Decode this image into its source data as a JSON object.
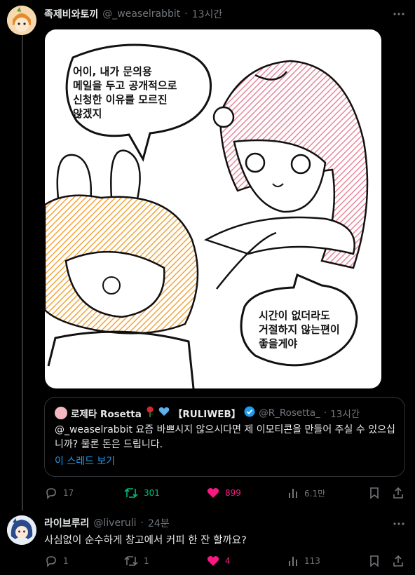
{
  "post": {
    "display_name": "족제비와토끼",
    "handle": "@_weaselrabbit",
    "separator": "·",
    "time": "13시간",
    "bubble1": "어이, 내가 문의용\n메일을 두고 공개적으로\n신청한 이유를 모르진\n않겠지",
    "bubble2": "시간이 없더라도\n거절하지 않는편이\n좋을게야",
    "quote": {
      "display_name": "로제타 Rosetta",
      "badge_text": "【RULIWEB】",
      "handle": "@R_Rosetta_",
      "separator": "·",
      "time": "13시간",
      "text": "@_weaselrabbit 요즘 바쁘시지 않으시다면 제 이모티콘을 만들어 주실 수 있으십니까? 물론 돈은 드립니다.",
      "show_thread": "이 스레드 보기"
    },
    "stats": {
      "replies": "17",
      "reposts": "301",
      "likes": "899",
      "views": "6.1만"
    }
  },
  "reply": {
    "display_name": "라이브루리",
    "handle": "@liveruli",
    "separator": "·",
    "time": "24분",
    "text": "사심없이 순수하게 창고에서 커피 한 잔 할까요?",
    "stats": {
      "replies": "1",
      "reposts": "1",
      "likes": "4",
      "views": "113"
    }
  },
  "colors": {
    "background": "#000000",
    "text": "#e7e9ea",
    "muted": "#71767b",
    "repost_active": "#00ba7c",
    "like_active": "#f91880",
    "link": "#1d9bf0",
    "verified": "#1d9bf0"
  },
  "icons": [
    "more-icon",
    "reply-icon",
    "repost-icon",
    "like-icon",
    "views-icon",
    "bookmark-icon",
    "share-icon",
    "verified-icon",
    "rose-icon",
    "blue-heart-icon"
  ]
}
